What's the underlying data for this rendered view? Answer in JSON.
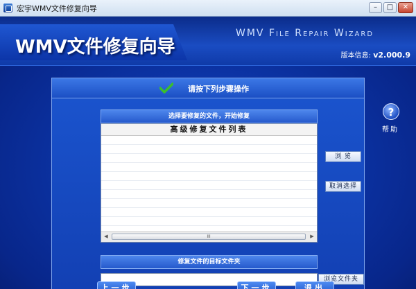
{
  "window": {
    "title": "宏宇WMV文件修复向导",
    "minimize": "–",
    "maximize": "□",
    "close": "✕"
  },
  "header": {
    "logo": "WMV文件修复向导",
    "subtitle": "WMV File Repair Wizard",
    "version_label": "版本信息:",
    "version_value": "v2.000.9"
  },
  "panel": {
    "heading": "请按下列步骤操作",
    "select_section": "选择要修复的文件，开始修复",
    "list_header": "高级修复文件列表",
    "target_section": "修复文件的目标文件夹",
    "target_value": ""
  },
  "scrollbar": {
    "thumb_grip": "III",
    "left_arrow": "◀",
    "right_arrow": "▶"
  },
  "buttons": {
    "browse": "浏 览",
    "cancel_select": "取消选择",
    "browse_folder": "浏览文件夹",
    "prev": "上一步",
    "next": "下一步",
    "exit": "退出"
  },
  "help": {
    "icon_glyph": "?",
    "label": "帮助"
  },
  "icons": {
    "check": "check-icon",
    "help": "help-icon",
    "app": "app-icon"
  },
  "colors": {
    "background": "#0a2a86",
    "accent": "#1b55cf",
    "check": "#3bbf2b"
  }
}
